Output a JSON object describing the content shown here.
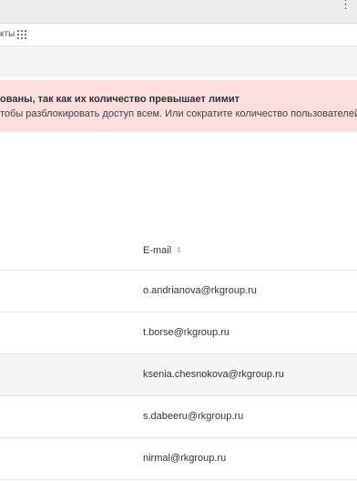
{
  "browser": {
    "menu_icon": "more-vertical-icon",
    "bookmarks_label": "кты",
    "apps_icon": "apps-grid-icon"
  },
  "alert": {
    "title": "ованы, так как их количество превышает лимит",
    "message": "тобы разблокировать доступ всем. Или сократите количество пользователей до",
    "background": "#fcdede"
  },
  "table": {
    "headers": {
      "email": "E-mail",
      "sort_icon": "sort-icon"
    },
    "rows": [
      {
        "email": "o.andrianova@rkgroup.ru"
      },
      {
        "email": "t.borse@rkgroup.ru"
      },
      {
        "email": "ksenia.chesnokova@rkgroup.ru"
      },
      {
        "email": "s.dabeeru@rkgroup.ru"
      },
      {
        "email": "nirmal@rkgroup.ru"
      }
    ]
  }
}
